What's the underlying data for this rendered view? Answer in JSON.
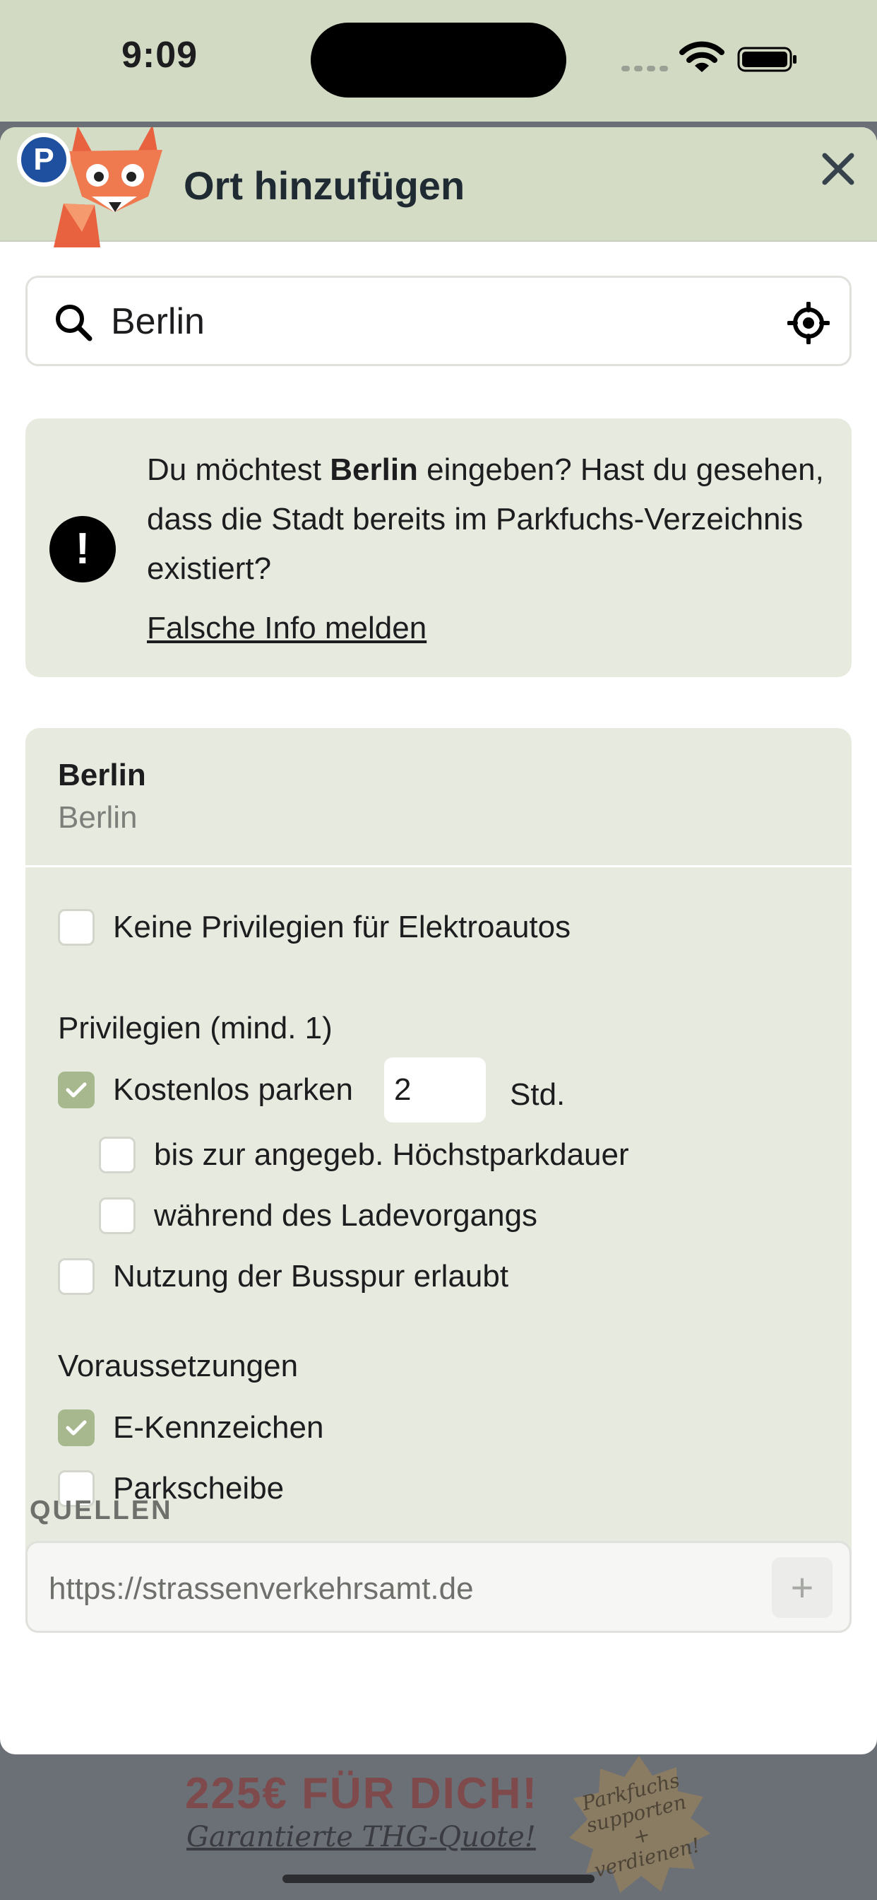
{
  "status_bar": {
    "time": "9:09"
  },
  "header": {
    "badge": "P",
    "title": "Ort hinzufügen"
  },
  "search": {
    "value": "Berlin"
  },
  "info": {
    "text_before": "Du möchtest ",
    "text_bold": "Berlin",
    "text_after": " eingeben? Hast du gesehen, dass die Stadt bereits im Parkfuchs-Verzeichnis existiert?",
    "link": "Falsche Info melden",
    "icon": "!"
  },
  "card": {
    "title": "Berlin",
    "subtitle": "Berlin",
    "no_privileges": {
      "label": "Keine Privilegien für Elektroautos",
      "checked": false
    },
    "privileges_label": "Privilegien (mind. 1)",
    "free_parking": {
      "label": "Kostenlos parken",
      "checked": true,
      "hours": "2",
      "unit": "Std."
    },
    "max_duration": {
      "label": "bis zur angegeb. Höchstparkdauer",
      "checked": false
    },
    "during_charging": {
      "label": "während des Ladevorgangs",
      "checked": false
    },
    "bus_lane": {
      "label": "Nutzung der Busspur erlaubt",
      "checked": false
    },
    "requirements_label": "Voraussetzungen",
    "e_plate": {
      "label": "E-Kennzeichen",
      "checked": true
    },
    "parking_disc": {
      "label": "Parkscheibe",
      "checked": false
    }
  },
  "sources": {
    "label": "QUELLEN",
    "value": "https://strassenverkehrsamt.de",
    "add": "+"
  },
  "ad": {
    "title": "225€ FÜR DICH!",
    "subtitle": "Garantierte THG-Quote!",
    "badge_line1": "Parkfuchs",
    "badge_line2": "supporten +",
    "badge_line3": "verdienen!"
  },
  "colors": {
    "header_bg": "#d4dcc6",
    "card_bg": "#e7eadf",
    "checkbox_checked": "#a7b88e",
    "ad_title": "#7f4a4c"
  }
}
